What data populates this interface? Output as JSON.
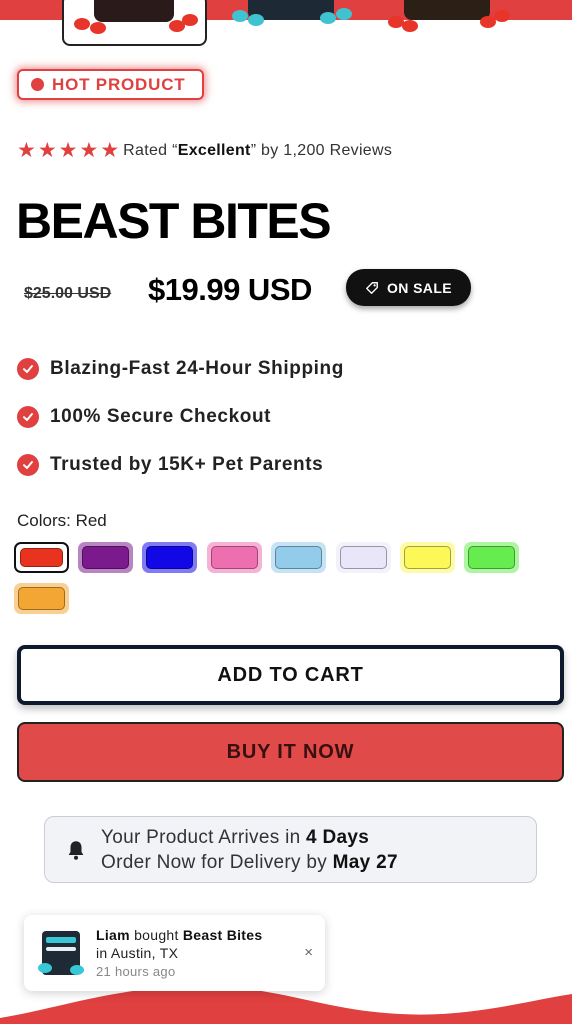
{
  "thumbnails": [
    {
      "name": "red",
      "selected": true
    },
    {
      "name": "blue",
      "selected": false
    },
    {
      "name": "orange",
      "selected": false
    }
  ],
  "hot_badge": {
    "label": "HOT PRODUCT"
  },
  "rating": {
    "stars": 5,
    "prefix": "Rated “",
    "quality": "Excellent",
    "suffix": "” by 1,200 Reviews"
  },
  "product": {
    "title": "BEAST BITES",
    "old_price": "$25.00 USD",
    "new_price": "$19.99 USD",
    "sale_badge": "ON SALE"
  },
  "features": [
    "Blazing-Fast 24-Hour Shipping",
    "100% Secure Checkout",
    "Trusted by 15K+ Pet Parents"
  ],
  "colors": {
    "label": "Colors: Red",
    "options": [
      {
        "name": "Red",
        "hex": "#e8341f",
        "selected": true
      },
      {
        "name": "Purple",
        "hex": "#7a1a8c",
        "selected": false
      },
      {
        "name": "Blue",
        "hex": "#1208e6",
        "selected": false
      },
      {
        "name": "Pink",
        "hex": "#ee6fb0",
        "selected": false
      },
      {
        "name": "Light Blue",
        "hex": "#93cbea",
        "selected": false
      },
      {
        "name": "Lavender",
        "hex": "#e8e6f8",
        "selected": false
      },
      {
        "name": "Yellow",
        "hex": "#fbf857",
        "selected": false
      },
      {
        "name": "Green",
        "hex": "#66ec4f",
        "selected": false
      },
      {
        "name": "Orange",
        "hex": "#f3a633",
        "selected": false
      }
    ]
  },
  "buttons": {
    "add_to_cart": "ADD TO CART",
    "buy_now": "BUY IT NOW"
  },
  "delivery": {
    "line1_prefix": "Your Product Arrives in ",
    "line1_bold": "4 Days",
    "line2_prefix": "Order Now for Delivery by ",
    "line2_bold": "May 27"
  },
  "toast": {
    "buyer": "Liam",
    "action": " bought ",
    "product": "Beast Bites",
    "location": "in Austin, TX",
    "time": "21 hours ago",
    "close": "×"
  },
  "theme": {
    "accent": "#e0403f",
    "dark": "#111111"
  }
}
